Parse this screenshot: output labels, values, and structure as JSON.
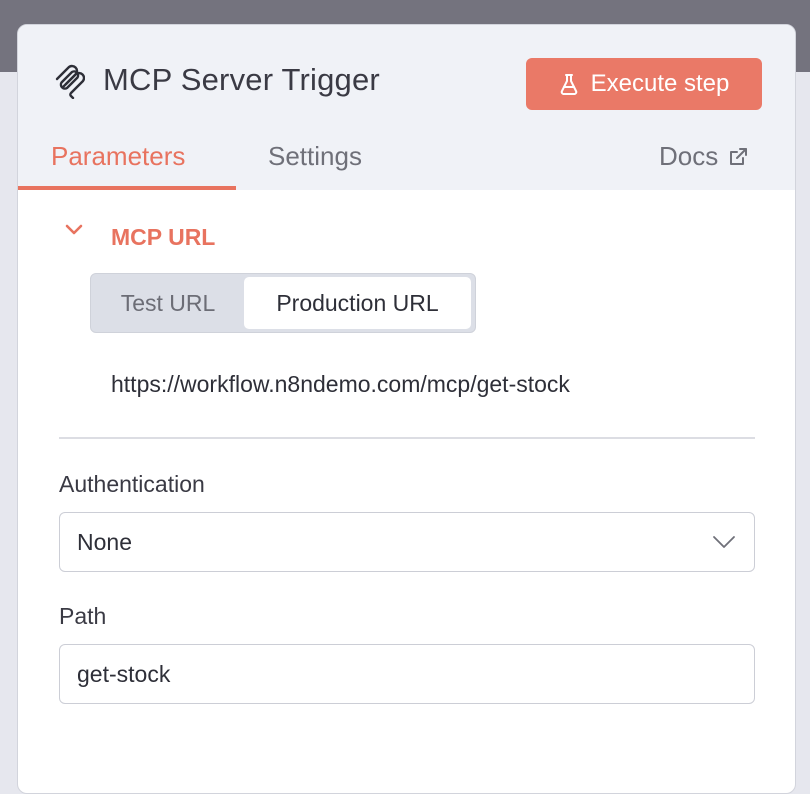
{
  "header": {
    "title": "MCP Server Trigger",
    "icon": "mcp-icon",
    "execute_label": "Execute step"
  },
  "tabs": [
    {
      "label": "Parameters",
      "active": true
    },
    {
      "label": "Settings",
      "active": false
    }
  ],
  "docs": {
    "label": "Docs",
    "icon": "external-link-icon"
  },
  "mcp_section": {
    "title": "MCP URL",
    "expanded": true,
    "toggle": {
      "options": [
        "Test URL",
        "Production URL"
      ],
      "selected": "Production URL"
    },
    "url": "https://workflow.n8ndemo.com/mcp/get-stock"
  },
  "fields": {
    "authentication": {
      "label": "Authentication",
      "value": "None"
    },
    "path": {
      "label": "Path",
      "value": "get-stock"
    }
  },
  "colors": {
    "accent": "#e8735f",
    "button": "#ea7967",
    "header_bg": "#f0f2f7",
    "backdrop": "#74737e"
  }
}
